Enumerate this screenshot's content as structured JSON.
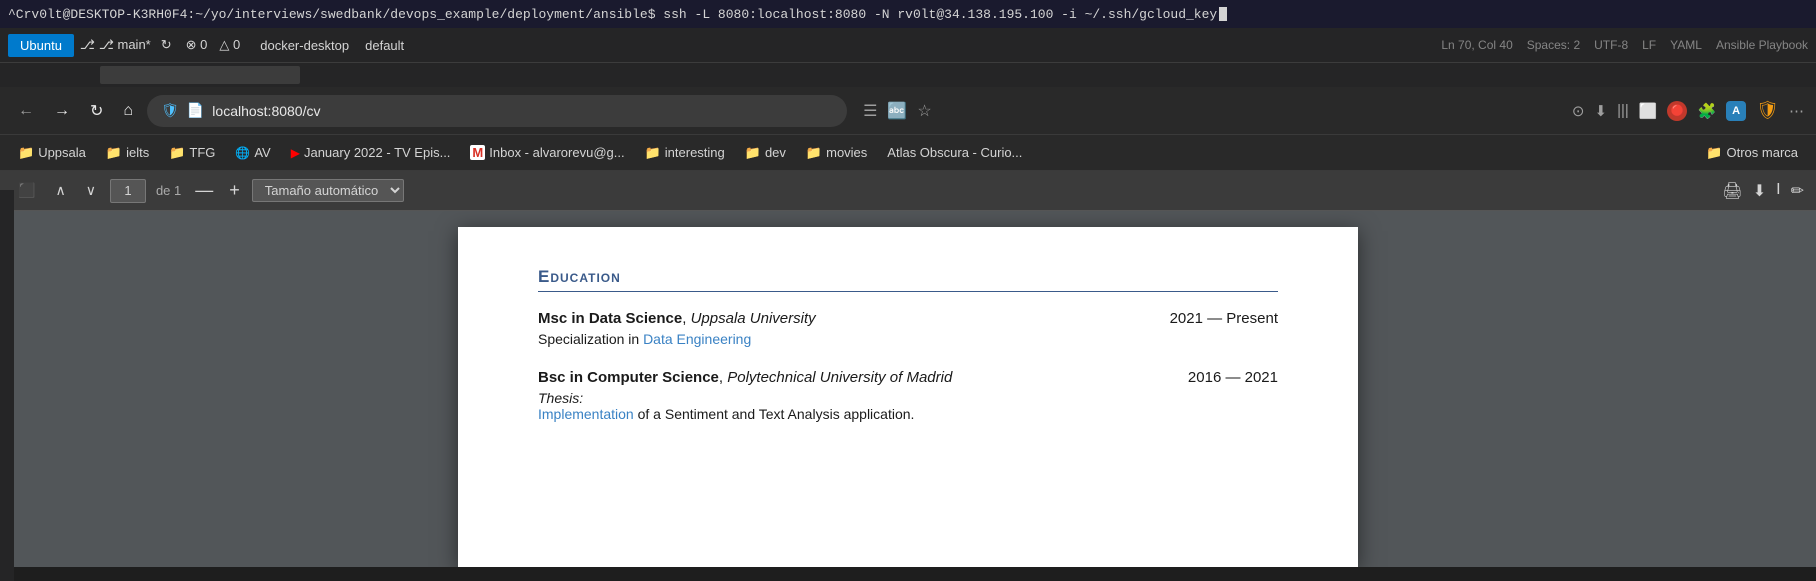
{
  "terminal": {
    "text": "^Crv0lt@DESKTOP-K3RH0F4:~/yo/interviews/swedbank/devops_example/deployment/ansible$ ssh -L 8080:localhost:8080 -N rv0lt@34.138.195.100 -i ~/.ssh/gcloud_key"
  },
  "vscode_tabs": {
    "ubuntu_label": "Ubuntu",
    "branch_label": "⎇ main*",
    "sync_icon": "↻",
    "errors": "⊗ 0",
    "warnings": "△ 0",
    "docker": "docker-desktop",
    "default": "default",
    "status_right": {
      "ln": "Ln 70, Col 40",
      "spaces": "Spaces: 2",
      "encoding": "UTF-8",
      "eol": "LF",
      "lang": "YAML",
      "playbook": "Ansible Playbook"
    }
  },
  "browser": {
    "url": "localhost:8080/cv",
    "back_label": "←",
    "forward_label": "→",
    "refresh_label": "↻",
    "home_label": "⌂"
  },
  "bookmarks": [
    {
      "id": "Uppsala",
      "label": "Uppsala",
      "type": "folder"
    },
    {
      "id": "ielts",
      "label": "ielts",
      "type": "folder"
    },
    {
      "id": "TFG",
      "label": "TFG",
      "type": "folder"
    },
    {
      "id": "AV",
      "label": "AV",
      "type": "globe"
    },
    {
      "id": "January2022",
      "label": "January 2022 - TV Epis...",
      "type": "youtube"
    },
    {
      "id": "Inbox",
      "label": "Inbox - alvarorevu@g...",
      "type": "gmail"
    },
    {
      "id": "interesting",
      "label": "interesting",
      "type": "folder"
    },
    {
      "id": "dev",
      "label": "dev",
      "type": "folder"
    },
    {
      "id": "movies",
      "label": "movies",
      "type": "folder"
    },
    {
      "id": "AtlasObscura",
      "label": "Atlas Obscura - Curio...",
      "type": "text"
    },
    {
      "id": "OtrosMarca",
      "label": "Otros marca",
      "type": "folder"
    }
  ],
  "pdf_toolbar": {
    "page_current": "1",
    "page_total": "de 1",
    "zoom_label": "Tamaño automático",
    "minus_label": "—",
    "plus_label": "+"
  },
  "cv": {
    "education_title": "Education",
    "entry1": {
      "degree": "Msc in Data Science",
      "university": "Uppsala University",
      "date": "2021 — Present",
      "specialization_prefix": "Specialization in ",
      "specialization_link": "Data Engineering"
    },
    "entry2": {
      "degree": "Bsc in Computer Science",
      "university": "Polytechnical University of Madrid",
      "date": "2016 — 2021",
      "thesis_label": "Thesis:",
      "thesis_link": "Implementation",
      "thesis_rest": " of a Sentiment and Text Analysis application."
    }
  }
}
